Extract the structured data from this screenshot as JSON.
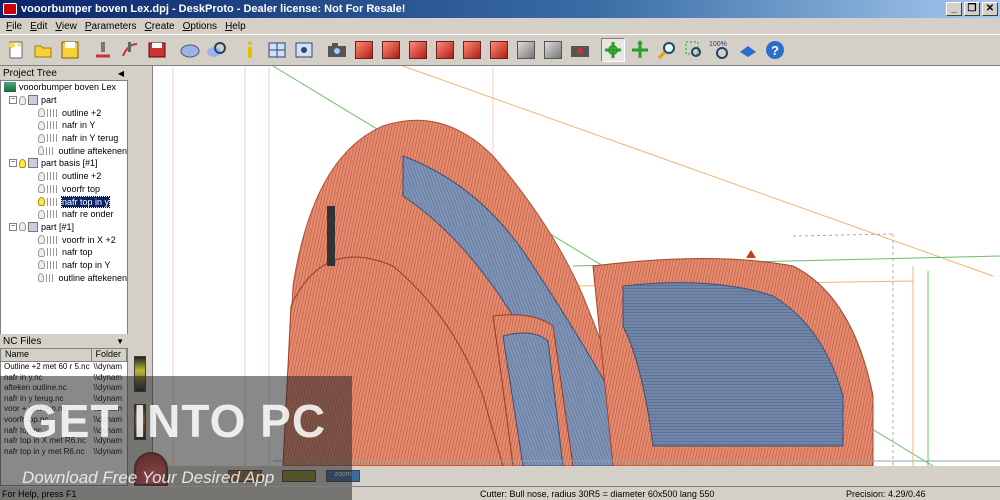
{
  "window": {
    "title": "vooorbumper boven Lex.dpj - DeskProto - Dealer license: Not For Resale!",
    "controls": [
      "_",
      "❐",
      "✕"
    ]
  },
  "menu": [
    "File",
    "Edit",
    "View",
    "Parameters",
    "Create",
    "Options",
    "Help"
  ],
  "toolbar": {
    "icons": [
      "new-file-icon",
      "open-folder-icon",
      "save-icon",
      "machine-icon",
      "toolpath-icon",
      "save-nc-icon",
      "part-icon",
      "zoom-part-icon",
      "info-icon",
      "window-icon",
      "viewport-icon",
      "camera-icon",
      "view-front-icon",
      "view-back-icon",
      "view-left-icon",
      "view-right-icon",
      "view-top-icon",
      "view-bottom-icon",
      "view-iso-icon",
      "view-shaded-icon",
      "screenshot-icon",
      "rotate-icon",
      "pan-icon",
      "zoom-icon",
      "zoom-window-icon",
      "zoom-100-icon",
      "manual-icon",
      "help-icon"
    ],
    "zoom_label": "100%"
  },
  "project_tree": {
    "title": "Project Tree",
    "items": [
      {
        "label": "vooorbumper boven Lex",
        "level": 0,
        "kind": "root"
      },
      {
        "label": "part",
        "level": 1,
        "kind": "part",
        "expander": "−"
      },
      {
        "label": "outline +2",
        "level": 2,
        "kind": "toolpath"
      },
      {
        "label": "nafr in Y",
        "level": 2,
        "kind": "toolpath"
      },
      {
        "label": "nafr in Y terug",
        "level": 2,
        "kind": "toolpath"
      },
      {
        "label": "outline aftekenen",
        "level": 2,
        "kind": "toolpath"
      },
      {
        "label": "part basis [#1]",
        "level": 1,
        "kind": "part",
        "expander": "−",
        "lit": true
      },
      {
        "label": "outline +2",
        "level": 2,
        "kind": "toolpath"
      },
      {
        "label": "voorfr top",
        "level": 2,
        "kind": "toolpath"
      },
      {
        "label": "nafr top in y",
        "level": 2,
        "kind": "toolpath",
        "selected": true,
        "lit": true
      },
      {
        "label": "nafr re onder",
        "level": 2,
        "kind": "toolpath"
      },
      {
        "label": "part [#1]",
        "level": 1,
        "kind": "part",
        "expander": "−"
      },
      {
        "label": "voorfr in X +2",
        "level": 2,
        "kind": "toolpath"
      },
      {
        "label": "nafr top",
        "level": 2,
        "kind": "toolpath"
      },
      {
        "label": "nafr top in Y",
        "level": 2,
        "kind": "toolpath"
      },
      {
        "label": "outline aftekenen",
        "level": 2,
        "kind": "toolpath"
      }
    ]
  },
  "nc_files": {
    "title": "NC Files",
    "columns": [
      "Name",
      "Folder"
    ],
    "rows": [
      {
        "name": "Outline +2 met 60 r 5.nc",
        "folder": "\\\\dynam"
      },
      {
        "name": "nafr in y.nc",
        "folder": "\\\\dynam"
      },
      {
        "name": "afteken outline.nc",
        "folder": "\\\\dynam"
      },
      {
        "name": "nafr in y terug.nc",
        "folder": "\\\\dynam"
      },
      {
        "name": "voor + nafr top.nc",
        "folder": "\\\\dynam"
      },
      {
        "name": "voorfr top.nc",
        "folder": "\\\\dynam"
      },
      {
        "name": "nafr top.nc",
        "folder": "\\\\dynam"
      },
      {
        "name": "nafr top in X met R6.nc",
        "folder": "\\\\dynam"
      },
      {
        "name": "nafr top in y met R6.nc",
        "folder": "\\\\dynam"
      }
    ]
  },
  "status": {
    "left": "For Help, press F1",
    "cutter": "Cutter: Bull nose, radius 30R5 = diameter 60x500 lang 550",
    "precision": "Precision: 4.29/0.46"
  },
  "bottom_controls": {
    "zoom_label": "zoom"
  },
  "watermark": {
    "title": "GET INTO PC",
    "subtitle": "Download Free Your Desired App"
  },
  "colors": {
    "titlebar": "#0a246a",
    "toolpath_orange": "#e07a5f",
    "model_blue": "#6f86a8",
    "selection": "#0a246a"
  }
}
